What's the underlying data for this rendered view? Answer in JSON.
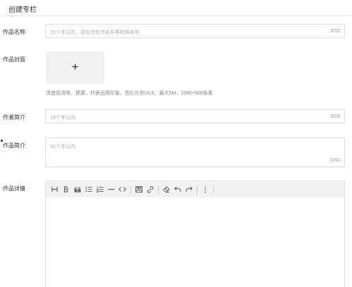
{
  "header": {
    "title": "创建专栏"
  },
  "form": {
    "title": {
      "label": "作品名称",
      "placeholder": "15个字以内，请勿添加书名号等特殊符号",
      "counter": "0/15"
    },
    "cover": {
      "label": "作品封面",
      "upload_glyph": "+",
      "hint": "请使用清晰、健康，代表品牌形象，图片比例16:9，最大5M，1080×608像素"
    },
    "author_intro": {
      "label": "作者简介",
      "placeholder": "19个字以内",
      "counter": "0/19"
    },
    "work_intro": {
      "label": "作品简介",
      "placeholder": "60个字以内",
      "counter": "0/60"
    },
    "details": {
      "label": "作品详情",
      "toolbar": [
        "heading-icon",
        "bold-icon",
        "quote-icon",
        "bullet-list-icon",
        "numbered-list-icon",
        "horizontal-rule-icon",
        "code-icon",
        "image-icon",
        "link-icon",
        "eraser-icon",
        "undo-icon",
        "redo-icon",
        "more-icon"
      ]
    }
  }
}
